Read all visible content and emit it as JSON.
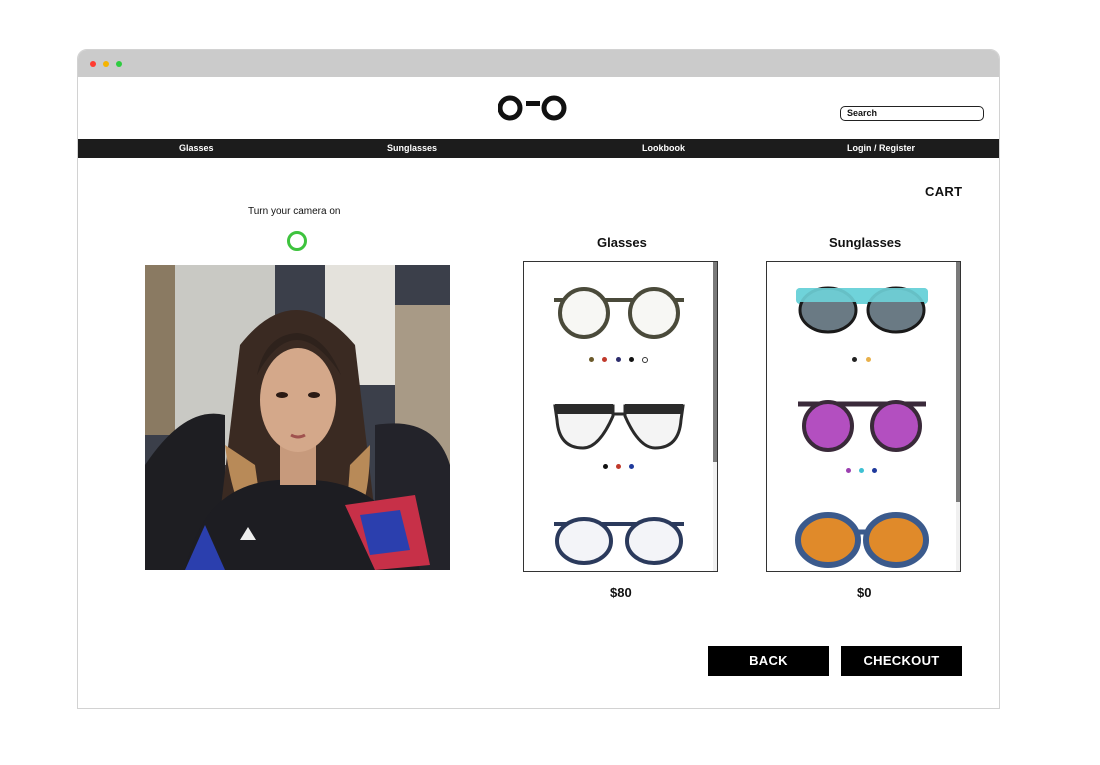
{
  "header": {
    "search_placeholder": "Search"
  },
  "nav": {
    "items": [
      {
        "label": "Glasses"
      },
      {
        "label": "Sunglasses"
      },
      {
        "label": "Lookbook"
      },
      {
        "label": "Login / Register"
      }
    ]
  },
  "cart_label": "CART",
  "camera": {
    "prompt": "Turn your camera on",
    "toggle_color": "#3ec33e"
  },
  "glasses": {
    "title": "Glasses",
    "price": "$80",
    "items": [
      {
        "frame_color": "#4a4a3a",
        "swatches": [
          "#6b5a2a",
          "#c0392b",
          "#2c2c6c",
          "#111111",
          "#ffffff"
        ]
      },
      {
        "frame_color": "#2a2a2a",
        "swatches": [
          "#111111",
          "#c0392b",
          "#1f3a9c"
        ]
      },
      {
        "frame_color": "#2b3a5c",
        "swatches": []
      }
    ]
  },
  "sunglasses": {
    "title": "Sunglasses",
    "price": "$0",
    "items": [
      {
        "frame_color": "#6fd3d9",
        "lens_color": "#6a7a84",
        "swatches": [
          "#222222",
          "#e8b04a"
        ]
      },
      {
        "frame_color": "#3a2a3a",
        "lens_color": "#b34fc0",
        "swatches": [
          "#9b3fb0",
          "#3ec1d3",
          "#1f3a9c"
        ]
      },
      {
        "frame_color": "#3b5a8c",
        "lens_color": "#e08a2a",
        "swatches": []
      }
    ]
  },
  "actions": {
    "back_label": "BACK",
    "checkout_label": "CHECKOUT"
  }
}
